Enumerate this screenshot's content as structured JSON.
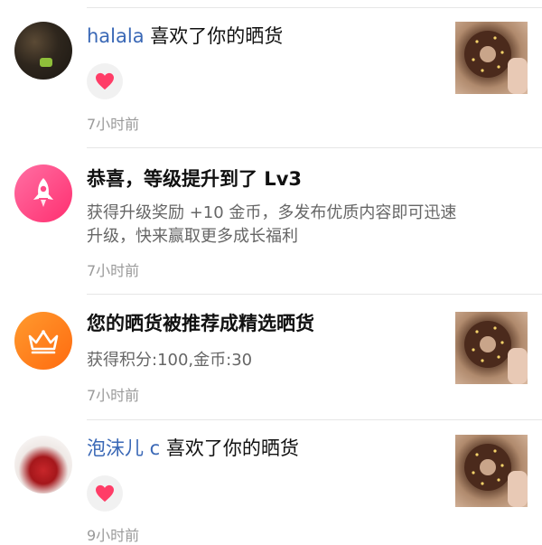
{
  "notifications": [
    {
      "type": "like",
      "user": "halala",
      "action": " 喜欢了你的晒货",
      "time": "7小时前"
    },
    {
      "type": "level-up",
      "title": "恭喜，等级提升到了 Lv3",
      "body": "获得升级奖励 +10 金币，多发布优质内容即可迅速升级，快来赢取更多成长福利",
      "time": "7小时前"
    },
    {
      "type": "featured",
      "title": "您的晒货被推荐成精选晒货",
      "body": "获得积分:100,金币:30",
      "time": "7小时前"
    },
    {
      "type": "like",
      "user": "泡沫儿 c",
      "action": " 喜欢了你的晒货",
      "time": "9小时前"
    }
  ],
  "colors": {
    "username": "#3a68b6",
    "heart": "#ff3d67",
    "rocket_bg": "#ff4a86",
    "crown_bg": "#ff8a1f"
  }
}
